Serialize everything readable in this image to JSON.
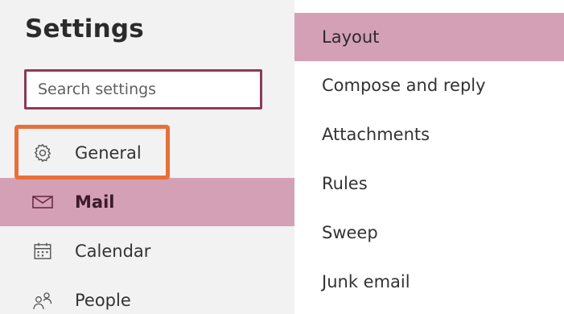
{
  "settings": {
    "title": "Settings",
    "search_placeholder": "Search settings"
  },
  "nav": {
    "items": [
      {
        "label": "General",
        "icon": "gear-icon",
        "selected": false,
        "highlighted": true
      },
      {
        "label": "Mail",
        "icon": "mail-icon",
        "selected": true
      },
      {
        "label": "Calendar",
        "icon": "calendar-icon",
        "selected": false
      },
      {
        "label": "People",
        "icon": "people-icon",
        "selected": false
      }
    ]
  },
  "mail_submenu": {
    "items": [
      {
        "label": "Layout",
        "selected": true
      },
      {
        "label": "Compose and reply",
        "selected": false
      },
      {
        "label": "Attachments",
        "selected": false
      },
      {
        "label": "Rules",
        "selected": false
      },
      {
        "label": "Sweep",
        "selected": false
      },
      {
        "label": "Junk email",
        "selected": false
      }
    ]
  },
  "colors": {
    "selection": "#d4a0b6",
    "accent": "#8b3a59",
    "callout": "#e7703a",
    "left_pane_bg": "#f2f2f2"
  }
}
